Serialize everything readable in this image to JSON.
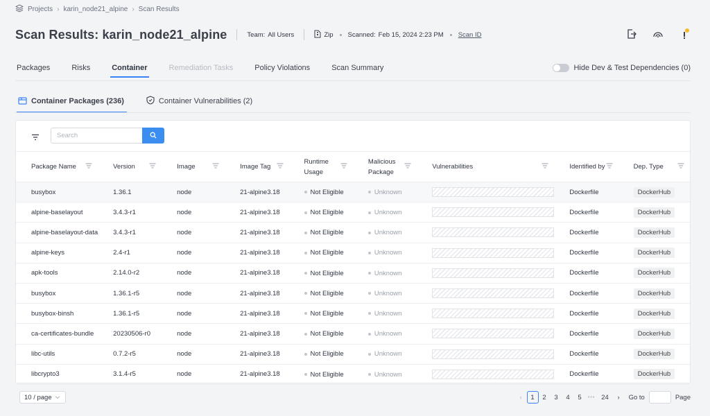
{
  "breadcrumb": [
    "Projects",
    "karin_node21_alpine",
    "Scan Results"
  ],
  "title": "Scan Results: karin_node21_alpine",
  "meta": {
    "team_label": "Team:",
    "team_value": "All Users",
    "source": "Zip",
    "scanned_label": "Scanned:",
    "scanned_value": "Feb 15, 2024 2:23 PM",
    "scan_id_link": "Scan ID"
  },
  "tabs": [
    "Packages",
    "Risks",
    "Container",
    "Remediation Tasks",
    "Policy Violations",
    "Scan Summary"
  ],
  "active_tab": "Container",
  "toggle_label": "Hide Dev & Test Dependencies (0)",
  "subtabs": [
    "Container Packages (236)",
    "Container Vulnerabilities (2)"
  ],
  "search_placeholder": "Search",
  "columns": [
    "Package Name",
    "Version",
    "Image",
    "Image Tag",
    "Runtime Usage",
    "Malicious Package",
    "Vulnerabilities",
    "Identified by",
    "Dep. Type"
  ],
  "rows": [
    {
      "name": "busybox",
      "version": "1.36.1",
      "image": "node",
      "tag": "21-alpine3.18",
      "runtime": "Not Eligible",
      "malicious": "Unknown",
      "identified": "Dockerfile",
      "dep": "DockerHub"
    },
    {
      "name": "alpine-baselayout",
      "version": "3.4.3-r1",
      "image": "node",
      "tag": "21-alpine3.18",
      "runtime": "Not Eligible",
      "malicious": "Unknown",
      "identified": "Dockerfile",
      "dep": "DockerHub"
    },
    {
      "name": "alpine-baselayout-data",
      "version": "3.4.3-r1",
      "image": "node",
      "tag": "21-alpine3.18",
      "runtime": "Not Eligible",
      "malicious": "Unknown",
      "identified": "Dockerfile",
      "dep": "DockerHub"
    },
    {
      "name": "alpine-keys",
      "version": "2.4-r1",
      "image": "node",
      "tag": "21-alpine3.18",
      "runtime": "Not Eligible",
      "malicious": "Unknown",
      "identified": "Dockerfile",
      "dep": "DockerHub"
    },
    {
      "name": "apk-tools",
      "version": "2.14.0-r2",
      "image": "node",
      "tag": "21-alpine3.18",
      "runtime": "Not Eligible",
      "malicious": "Unknown",
      "identified": "Dockerfile",
      "dep": "DockerHub"
    },
    {
      "name": "busybox",
      "version": "1.36.1-r5",
      "image": "node",
      "tag": "21-alpine3.18",
      "runtime": "Not Eligible",
      "malicious": "Unknown",
      "identified": "Dockerfile",
      "dep": "DockerHub"
    },
    {
      "name": "busybox-binsh",
      "version": "1.36.1-r5",
      "image": "node",
      "tag": "21-alpine3.18",
      "runtime": "Not Eligible",
      "malicious": "Unknown",
      "identified": "Dockerfile",
      "dep": "DockerHub"
    },
    {
      "name": "ca-certificates-bundle",
      "version": "20230506-r0",
      "image": "node",
      "tag": "21-alpine3.18",
      "runtime": "Not Eligible",
      "malicious": "Unknown",
      "identified": "Dockerfile",
      "dep": "DockerHub"
    },
    {
      "name": "libc-utils",
      "version": "0.7.2-r5",
      "image": "node",
      "tag": "21-alpine3.18",
      "runtime": "Not Eligible",
      "malicious": "Unknown",
      "identified": "Dockerfile",
      "dep": "DockerHub"
    },
    {
      "name": "libcrypto3",
      "version": "3.1.4-r5",
      "image": "node",
      "tag": "21-alpine3.18",
      "runtime": "Not Eligible",
      "malicious": "Unknown",
      "identified": "Dockerfile",
      "dep": "DockerHub"
    }
  ],
  "page_size": "10 / page",
  "pagination": {
    "pages": [
      "1",
      "2",
      "3",
      "4",
      "5"
    ],
    "ellipsis": "•••",
    "last": "24",
    "goto_label": "Go to",
    "page_label": "Page",
    "current": "1"
  },
  "colors": {
    "accent": "#3b82f6",
    "search_button": "#3b8ef0"
  },
  "icons": [
    "layers-icon",
    "zip-file-icon",
    "export-icon",
    "radar-icon",
    "notification-icon",
    "filter-icon",
    "search-icon",
    "package-icon",
    "shield-icon",
    "column-filter-icon"
  ]
}
